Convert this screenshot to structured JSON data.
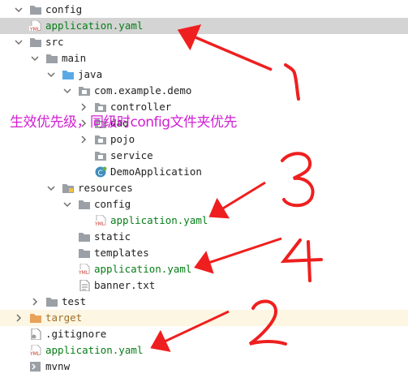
{
  "tree": [
    {
      "id": "config-top",
      "label": "config",
      "type": "folder",
      "arrow": "down",
      "selected": false,
      "color": "normal"
    },
    {
      "id": "application-yaml-config",
      "label": "application.yaml",
      "type": "yaml",
      "arrow": "none",
      "selected": true,
      "color": "green"
    },
    {
      "id": "src",
      "label": "src",
      "type": "folder",
      "arrow": "down",
      "color": "normal"
    },
    {
      "id": "main",
      "label": "main",
      "type": "folder",
      "arrow": "down",
      "color": "normal"
    },
    {
      "id": "java",
      "label": "java",
      "type": "folder-blue",
      "arrow": "down",
      "color": "normal"
    },
    {
      "id": "package",
      "label": "com.example.demo",
      "type": "package",
      "arrow": "down",
      "color": "normal"
    },
    {
      "id": "controller",
      "label": "controller",
      "type": "package",
      "arrow": "right",
      "color": "normal"
    },
    {
      "id": "dao",
      "label": "dao",
      "type": "package",
      "arrow": "right",
      "color": "normal"
    },
    {
      "id": "pojo",
      "label": "pojo",
      "type": "package",
      "arrow": "right",
      "color": "normal"
    },
    {
      "id": "service",
      "label": "service",
      "type": "package",
      "arrow": "none",
      "color": "normal"
    },
    {
      "id": "demo-application",
      "label": "DemoApplication",
      "type": "class",
      "arrow": "none",
      "color": "normal"
    },
    {
      "id": "resources",
      "label": "resources",
      "type": "resources",
      "arrow": "down",
      "color": "normal"
    },
    {
      "id": "resources-config",
      "label": "config",
      "type": "folder",
      "arrow": "down",
      "color": "normal"
    },
    {
      "id": "application-yaml-resources-config",
      "label": "application.yaml",
      "type": "yaml",
      "arrow": "none",
      "color": "green"
    },
    {
      "id": "static",
      "label": "static",
      "type": "folder",
      "arrow": "none",
      "color": "normal"
    },
    {
      "id": "templates",
      "label": "templates",
      "type": "folder",
      "arrow": "none",
      "color": "normal"
    },
    {
      "id": "application-yaml-resources",
      "label": "application.yaml",
      "type": "yaml",
      "arrow": "none",
      "color": "green"
    },
    {
      "id": "banner",
      "label": "banner.txt",
      "type": "text",
      "arrow": "none",
      "color": "normal"
    },
    {
      "id": "test",
      "label": "test",
      "type": "folder",
      "arrow": "right",
      "color": "normal"
    },
    {
      "id": "target",
      "label": "target",
      "type": "folder-orange",
      "arrow": "right",
      "highlight": true,
      "color": "orange"
    },
    {
      "id": "gitignore",
      "label": ".gitignore",
      "type": "gitignore",
      "arrow": "none",
      "color": "normal"
    },
    {
      "id": "application-yaml-root",
      "label": "application.yaml",
      "type": "yaml",
      "arrow": "none",
      "color": "green"
    },
    {
      "id": "mvnw",
      "label": "mvnw",
      "type": "script",
      "arrow": "none",
      "color": "normal"
    }
  ],
  "annotation": {
    "caption": "生效优先级，同级时config文件夹优先",
    "numbers": [
      "1",
      "2",
      "3",
      "4"
    ],
    "color": "#ef1f1f",
    "caption_color": "#d11fd4"
  },
  "icon_text": {
    "yaml": "YML"
  }
}
